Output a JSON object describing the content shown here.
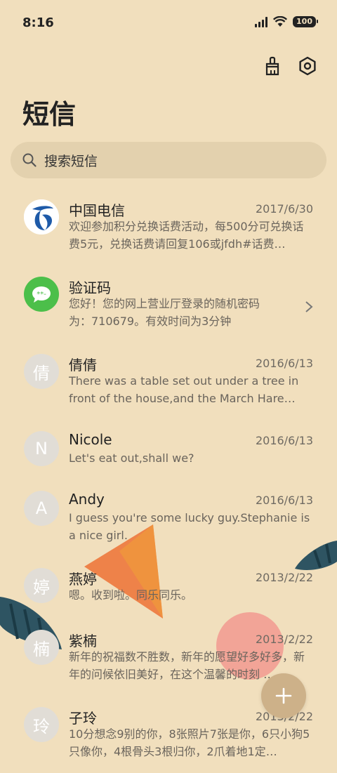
{
  "status_bar": {
    "time": "8:16",
    "battery": "100"
  },
  "header": {
    "title": "短信",
    "brush_icon": "brush-icon",
    "settings_icon": "gear-icon"
  },
  "search": {
    "placeholder": "搜索短信",
    "icon": "search-icon"
  },
  "messages": [
    {
      "avatar": "",
      "avatar_type": "china-telecom-logo",
      "name": "中国电信",
      "date": "2017/6/30",
      "preview": "欢迎参加积分兑换话费活动，每500分可兑换话费5元，兑换话费请回复106或jfdh#话费…"
    },
    {
      "avatar": "",
      "avatar_type": "sms-bubble-icon",
      "name": "验证码",
      "date": "",
      "preview": "您好！您的网上营业厅登录的随机密码为：710679。有效时间为3分钟"
    },
    {
      "avatar": "倩",
      "name": "倩倩",
      "date": "2016/6/13",
      "preview": "There was a table set out under a tree in front of the house,and the March Hare an…"
    },
    {
      "avatar": "N",
      "name": "Nicole",
      "date": "2016/6/13",
      "preview": "Let's eat out,shall we?"
    },
    {
      "avatar": "A",
      "name": "Andy",
      "date": "2016/6/13",
      "preview": "I guess you're some lucky guy.Stephanie is a nice girl."
    },
    {
      "avatar": "婷",
      "name": "燕婷",
      "date": "2013/2/22",
      "preview": "嗯。收到啦。同乐同乐。"
    },
    {
      "avatar": "楠",
      "name": "紫楠",
      "date": "2013/2/22",
      "preview": "新年的祝福数不胜数，新年的愿望好多好多，新年的问候依旧美好，在这个温馨的时刻 …"
    },
    {
      "avatar": "玲",
      "name": "子玲",
      "date": "2013/2/22",
      "preview": "10分想念9别的你，8张照片7张是你，6只小狗5只像你，4根骨头3根归你，2爪着地1定…"
    }
  ],
  "fab": {
    "label": "+",
    "icon": "plus-icon"
  },
  "colors": {
    "background": "#f1dfbd",
    "search_bg": "#e3d1ae",
    "fab": "#cdb189",
    "telecom_blue": "#1e5aa8",
    "sms_green": "#4cbf4a"
  }
}
